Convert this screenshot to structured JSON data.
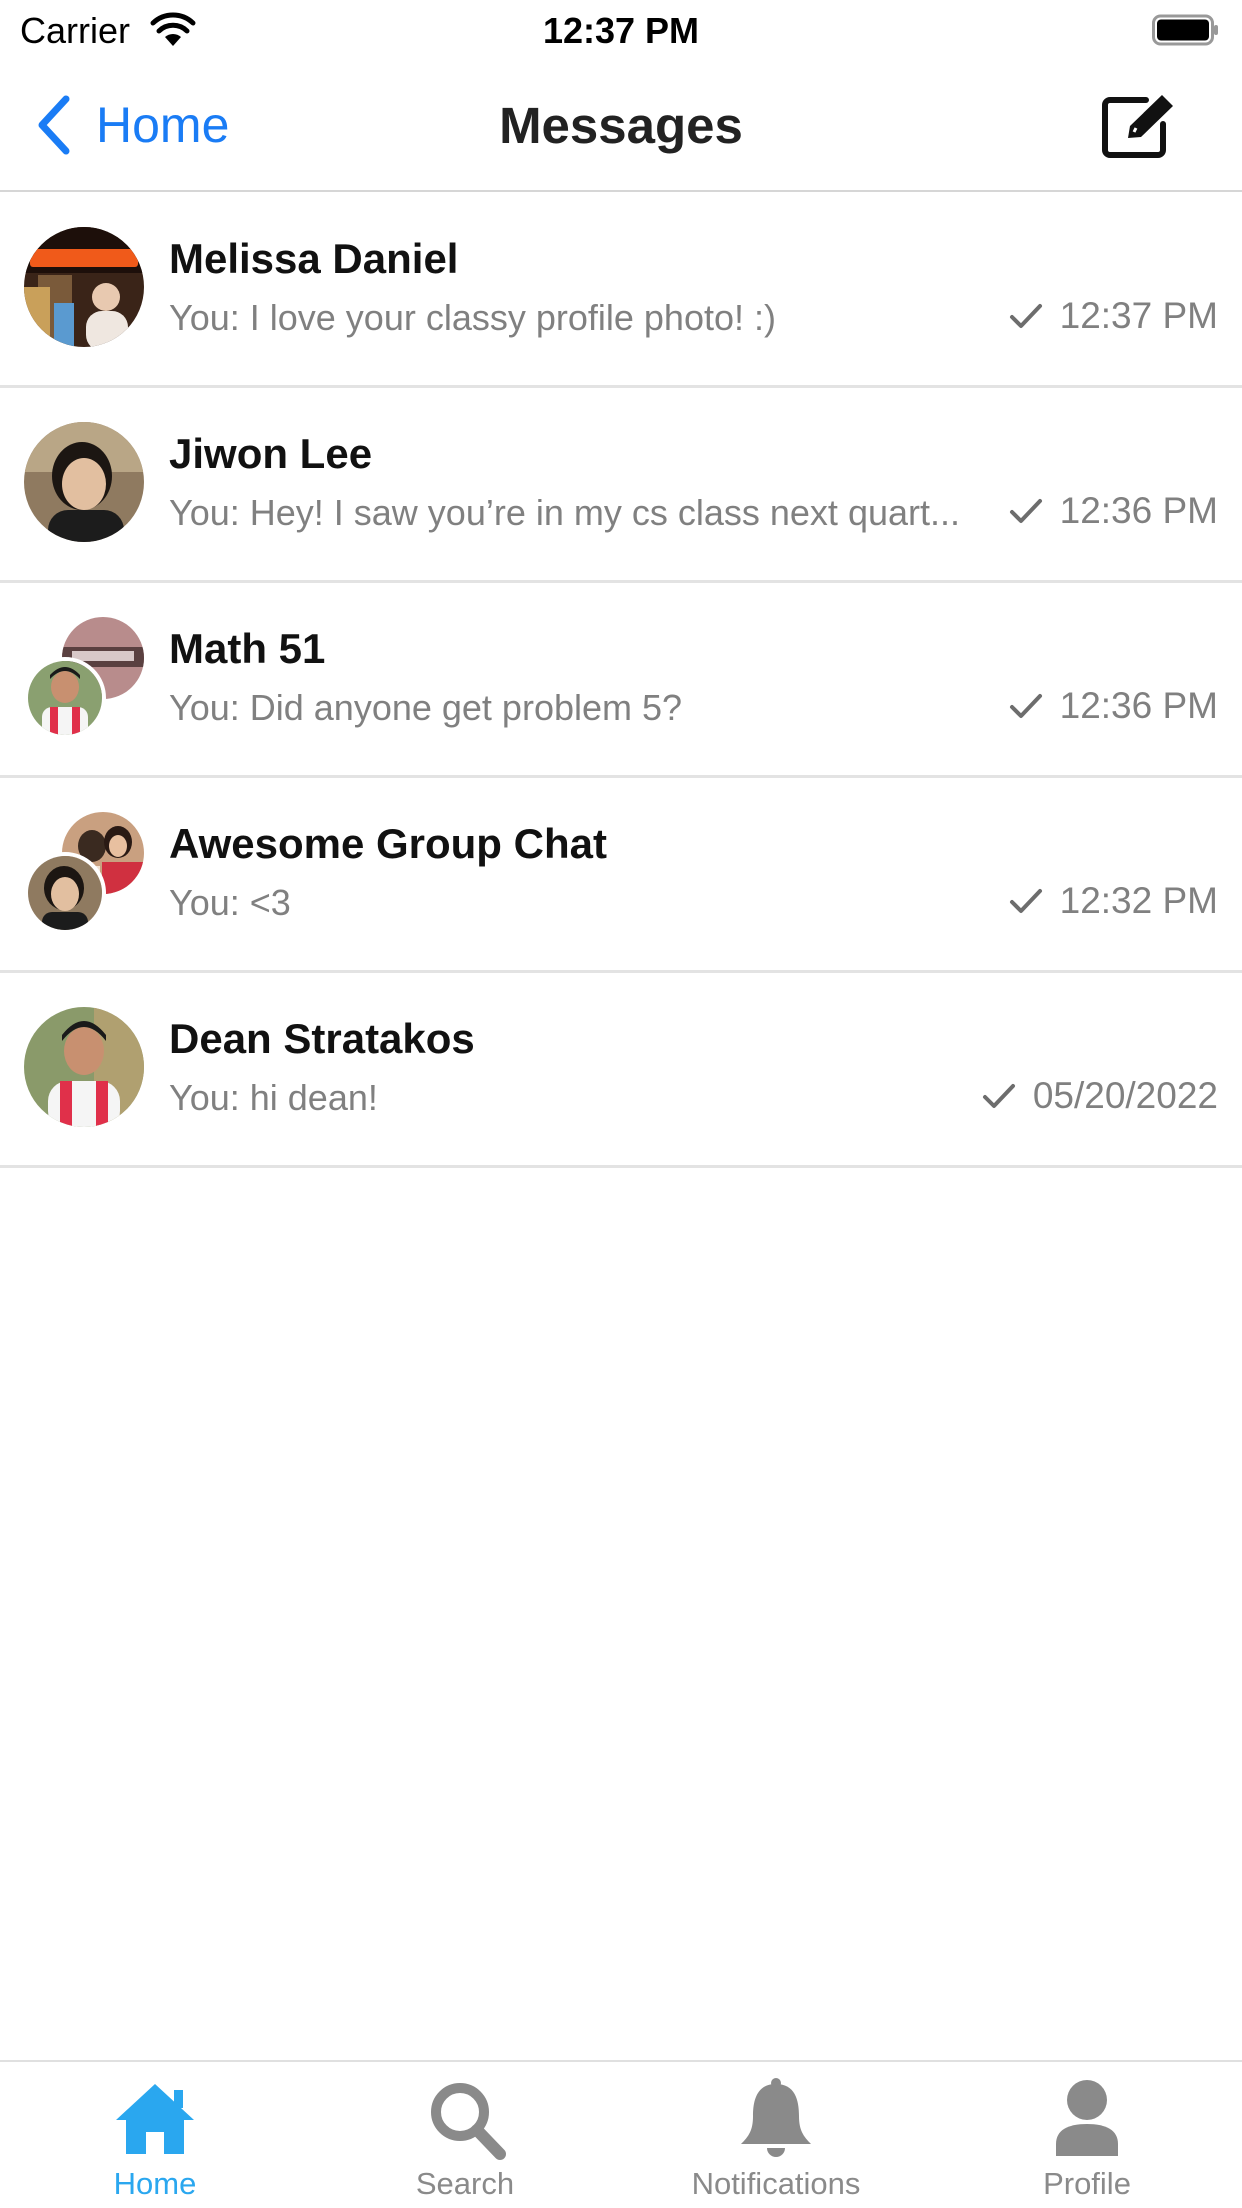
{
  "status_bar": {
    "carrier": "Carrier",
    "time": "12:37 PM"
  },
  "nav": {
    "back_label": "Home",
    "title": "Messages",
    "back_icon": "chevron-left-icon",
    "compose_icon": "compose-icon",
    "accent_color": "#1a7cf5"
  },
  "conversations": [
    {
      "name": "Melissa Daniel",
      "preview": "You: I love your classy profile photo! :)",
      "time": "12:37 PM",
      "status_icon": "check-icon"
    },
    {
      "name": "Jiwon Lee",
      "preview": "You: Hey! I saw you’re in my cs class next quart...",
      "time": "12:36 PM",
      "status_icon": "check-icon"
    },
    {
      "name": "Math 51",
      "preview": "You: Did anyone get problem 5?",
      "time": "12:36 PM",
      "status_icon": "check-icon"
    },
    {
      "name": "Awesome Group Chat",
      "preview": "You: <3",
      "time": "12:32 PM",
      "status_icon": "check-icon"
    },
    {
      "name": "Dean Stratakos",
      "preview": "You: hi dean!",
      "time": "05/20/2022",
      "status_icon": "check-icon"
    }
  ],
  "tabs": [
    {
      "label": "Home",
      "icon": "home-icon",
      "active": true
    },
    {
      "label": "Search",
      "icon": "search-icon",
      "active": false
    },
    {
      "label": "Notifications",
      "icon": "bell-icon",
      "active": false
    },
    {
      "label": "Profile",
      "icon": "person-icon",
      "active": false
    }
  ],
  "colors": {
    "tab_active": "#2aa7ef",
    "tab_inactive": "#8a8a8a",
    "secondary_text": "#808080"
  }
}
